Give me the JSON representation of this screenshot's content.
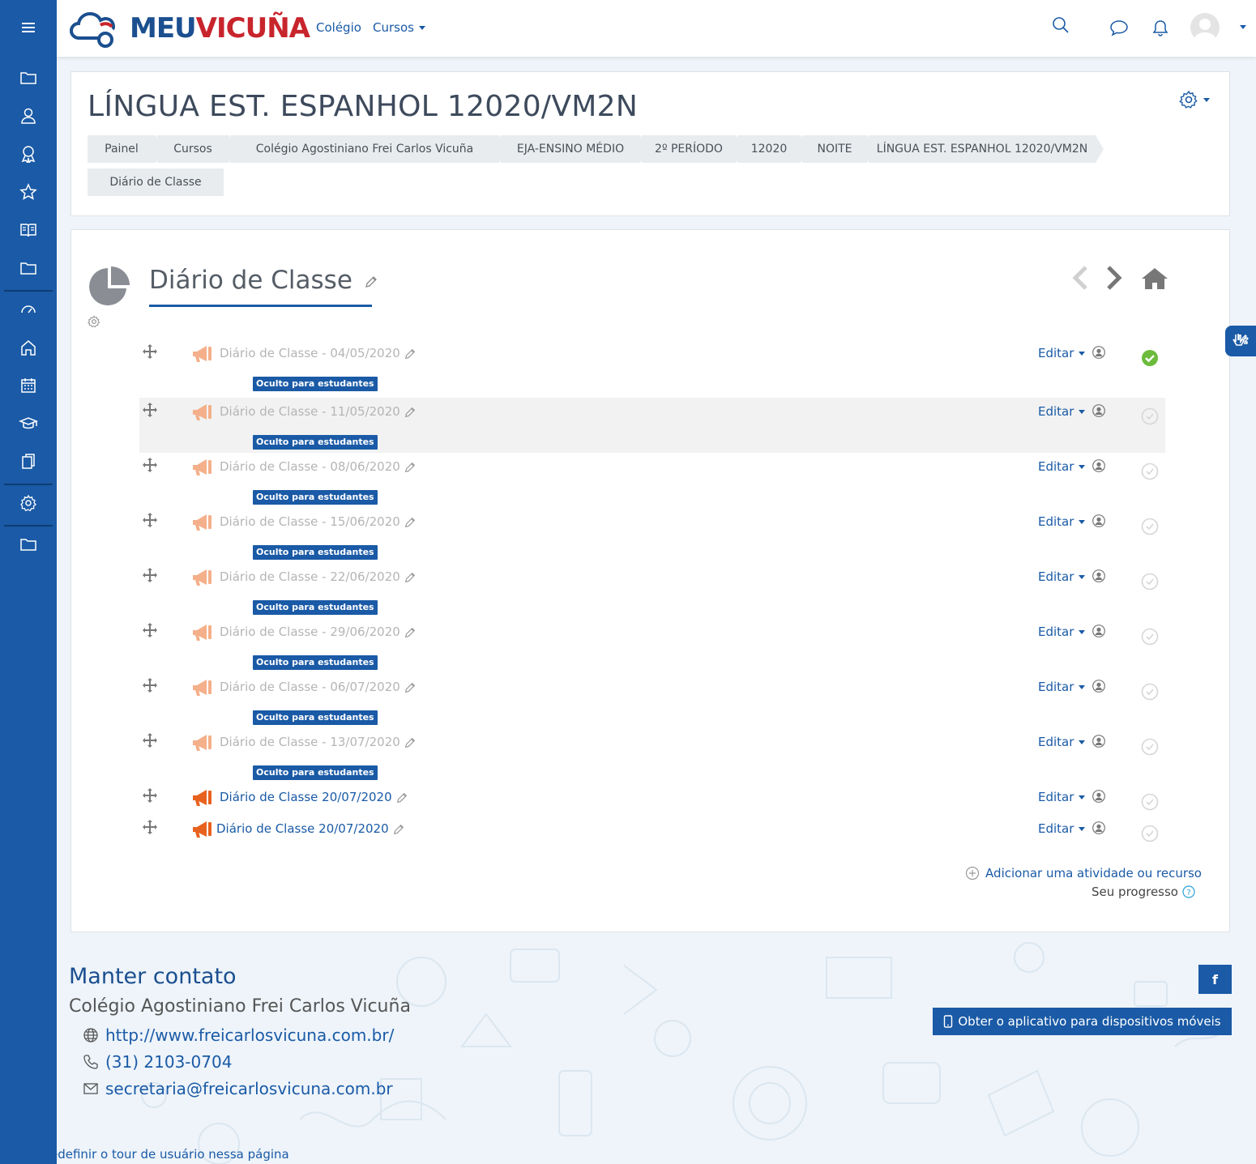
{
  "brand": {
    "logo_part1": "MEU",
    "logo_part2": "VICUÑA"
  },
  "navbar": {
    "colegio": "Colégio",
    "cursos": "Cursos"
  },
  "header": {
    "title": "LÍNGUA EST. ESPANHOL 12020/VM2N",
    "breadcrumb": [
      "Painel",
      "Cursos",
      "Colégio Agostiniano Frei Carlos Vicuña",
      "EJA-ENSINO MÉDIO",
      "2º PERÍODO",
      "12020",
      "NOITE",
      "LÍNGUA EST. ESPANHOL 12020/VM2N",
      "Diário de Classe"
    ]
  },
  "section": {
    "title": "Diário de Classe",
    "edit_label": "Editar",
    "hidden_badge": "Oculto para estudantes",
    "activities": [
      {
        "name": "Diário de Classe - 04/05/2020",
        "hidden": true,
        "complete": true
      },
      {
        "name": "Diário de Classe - 11/05/2020",
        "hidden": true,
        "complete": false
      },
      {
        "name": "Diário de Classe - 08/06/2020",
        "hidden": true,
        "complete": false
      },
      {
        "name": "Diário de Classe - 15/06/2020",
        "hidden": true,
        "complete": false
      },
      {
        "name": "Diário de Classe - 22/06/2020",
        "hidden": true,
        "complete": false
      },
      {
        "name": "Diário de Classe - 29/06/2020",
        "hidden": true,
        "complete": false
      },
      {
        "name": "Diário de Classe - 06/07/2020",
        "hidden": true,
        "complete": false
      },
      {
        "name": "Diário de Classe - 13/07/2020",
        "hidden": true,
        "complete": false
      },
      {
        "name": "Diário de Classe 20/07/2020",
        "hidden": false,
        "complete": false
      },
      {
        "name": "Diário de Classe 20/07/2020",
        "hidden": false,
        "complete": false
      }
    ],
    "add_activity": "Adicionar uma atividade ou recurso",
    "progress_label": "Seu progresso"
  },
  "footer": {
    "title": "Manter contato",
    "school": "Colégio Agostiniano Frei Carlos Vicuña",
    "website": "http://www.freicarlosvicuna.com.br/",
    "phone": "(31) 2103-0704",
    "email": "secretaria@freicarlosvicuna.com.br",
    "facebook": "f",
    "app_button": "Obter o aplicativo para dispositivos móveis",
    "tour_link": "edefinir o tour de usuário nessa página"
  },
  "colors": {
    "primary": "#1a5aa6",
    "hidden_text": "#b5b5b5",
    "complete": "#6cbb3c"
  }
}
